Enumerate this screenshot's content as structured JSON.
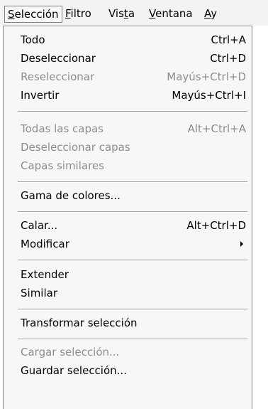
{
  "menubar": {
    "items": [
      {
        "label": "Selección",
        "active": true
      },
      {
        "label": "Filtro"
      },
      {
        "label": "Vista"
      },
      {
        "label": "Ventana"
      },
      {
        "label": "Ay"
      }
    ]
  },
  "menu": {
    "items": [
      {
        "label": "Todo",
        "shortcut": "Ctrl+A",
        "enabled": true
      },
      {
        "label": "Deseleccionar",
        "shortcut": "Ctrl+D",
        "enabled": true
      },
      {
        "label": "Reseleccionar",
        "shortcut": "Mayús+Ctrl+D",
        "enabled": false
      },
      {
        "label": "Invertir",
        "shortcut": "Mayús+Ctrl+I",
        "enabled": true
      },
      {
        "label": "Todas las capas",
        "shortcut": "Alt+Ctrl+A",
        "enabled": false
      },
      {
        "label": "Deseleccionar capas",
        "shortcut": "",
        "enabled": false
      },
      {
        "label": "Capas similares",
        "shortcut": "",
        "enabled": false
      },
      {
        "label": "Gama de colores...",
        "shortcut": "",
        "enabled": true
      },
      {
        "label": "Calar...",
        "shortcut": "Alt+Ctrl+D",
        "enabled": true
      },
      {
        "label": "Modificar",
        "shortcut": "",
        "enabled": true,
        "submenu": true
      },
      {
        "label": "Extender",
        "shortcut": "",
        "enabled": true
      },
      {
        "label": "Similar",
        "shortcut": "",
        "enabled": true
      },
      {
        "label": "Transformar selección",
        "shortcut": "",
        "enabled": true
      },
      {
        "label": "Cargar selección...",
        "shortcut": "",
        "enabled": false
      },
      {
        "label": "Guardar selección...",
        "shortcut": "",
        "enabled": true
      }
    ]
  },
  "colors": {
    "menu_background": "#f7f7f7",
    "disabled_text": "#8d8d8d",
    "separator": "#a0a0a0"
  }
}
